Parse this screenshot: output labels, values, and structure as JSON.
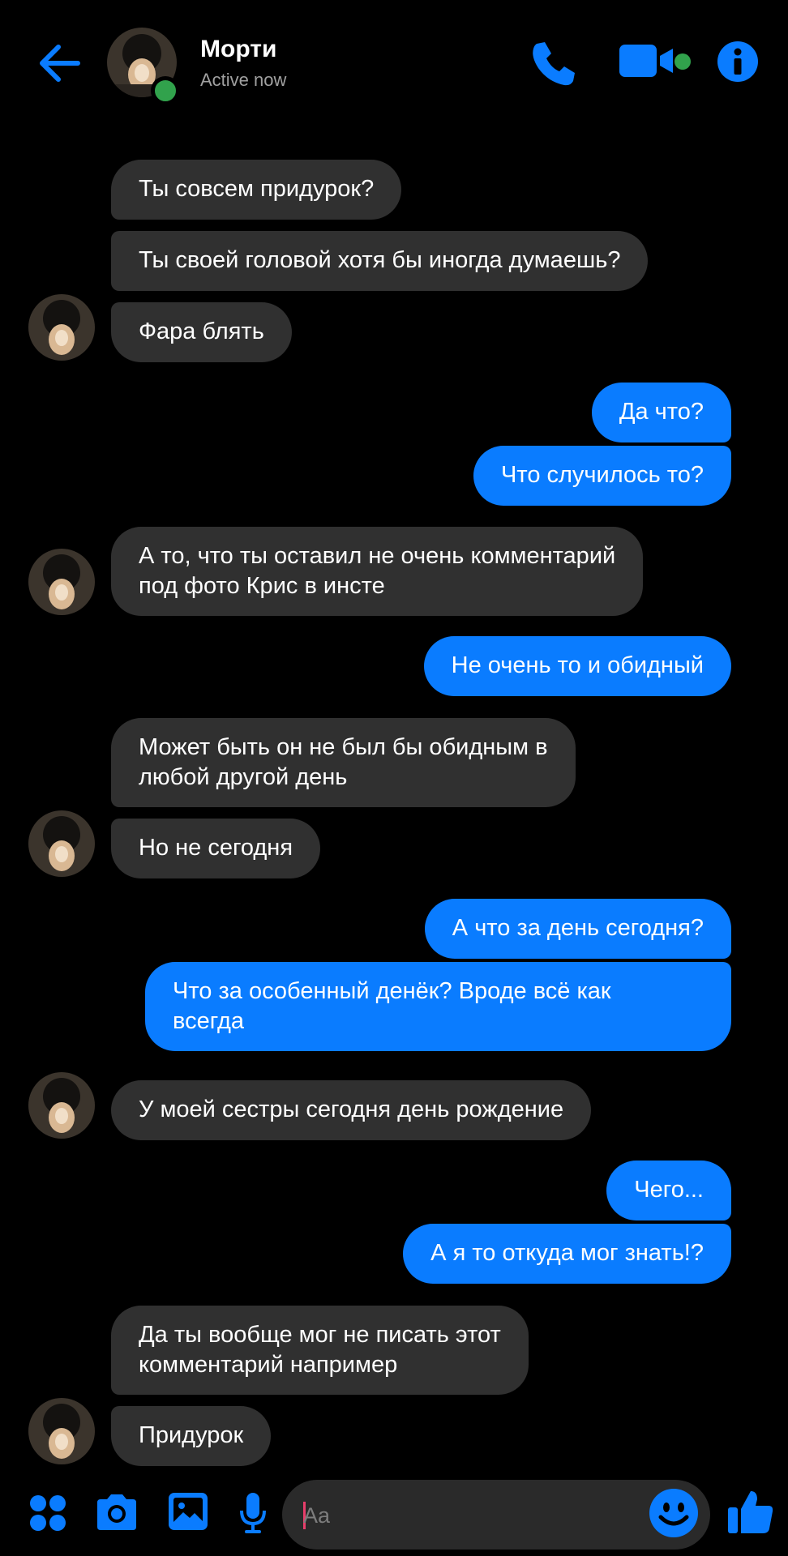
{
  "header": {
    "name": "Морти",
    "status": "Active now"
  },
  "messages": [
    {
      "side": "in",
      "text": "Ты совсем придурок?"
    },
    {
      "side": "in",
      "text": "Ты своей головой хотя бы иногда думаешь?"
    },
    {
      "side": "in",
      "text": "Фара блять"
    },
    {
      "side": "out",
      "text": "Да что?"
    },
    {
      "side": "out",
      "text": "Что случилось то?"
    },
    {
      "side": "in",
      "lines": [
        "А то, что ты оставил не очень комментарий",
        "под фото Крис в инсте"
      ]
    },
    {
      "side": "out",
      "text": "Не очень то и обидный"
    },
    {
      "side": "in",
      "lines": [
        "Может быть он не был бы обидным в",
        "любой другой день"
      ]
    },
    {
      "side": "in",
      "text": "Но не сегодня"
    },
    {
      "side": "out",
      "text": "А что за день сегодня?"
    },
    {
      "side": "out",
      "lines": [
        "Что за особенный денёк? Вроде всё как",
        "всегда"
      ]
    },
    {
      "side": "in",
      "text": "У моей сестры сегодня день рождение"
    },
    {
      "side": "out",
      "text": "Чего..."
    },
    {
      "side": "out",
      "text": "А я то откуда мог знать!?"
    },
    {
      "side": "in",
      "lines": [
        "Да ты вообще мог не писать этот",
        "комментарий например"
      ]
    },
    {
      "side": "in",
      "text": "Придурок"
    }
  ],
  "composer": {
    "placeholder": "Aa"
  },
  "colors": {
    "accent": "#0a7cff",
    "incoming_bubble": "#303030",
    "online": "#31a24c",
    "background": "#000000"
  },
  "icons": [
    "back-arrow-icon",
    "phone-icon",
    "video-camera-icon",
    "info-icon",
    "apps-grid-icon",
    "camera-icon",
    "gallery-icon",
    "microphone-icon",
    "emoji-icon",
    "thumbs-up-icon"
  ]
}
